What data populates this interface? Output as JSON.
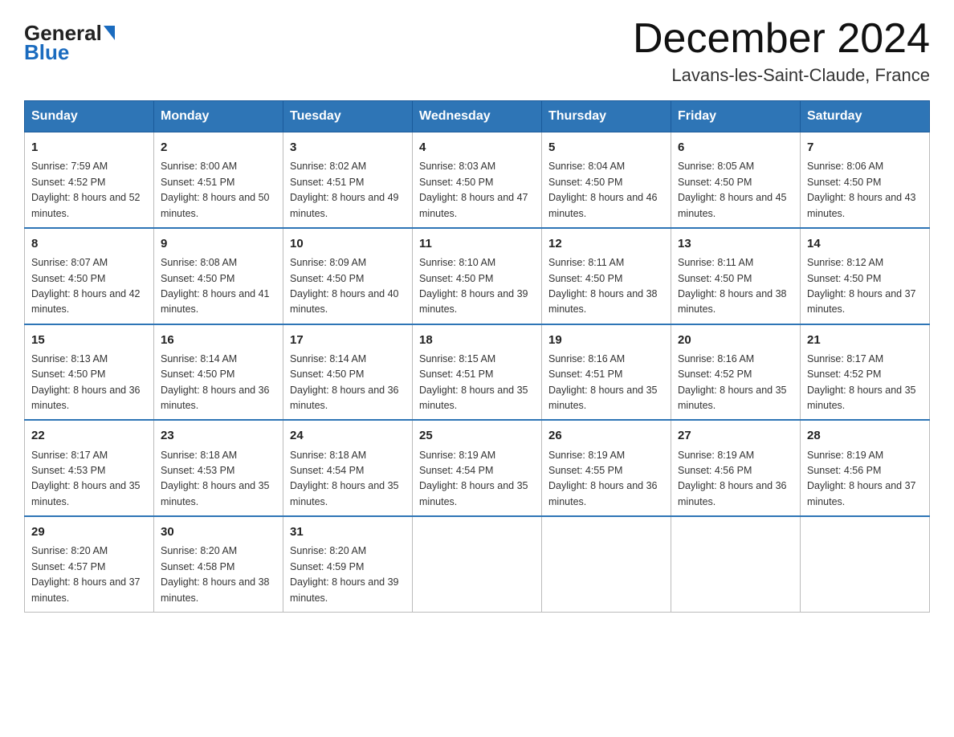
{
  "header": {
    "logo_general": "General",
    "logo_blue": "Blue",
    "month_year": "December 2024",
    "location": "Lavans-les-Saint-Claude, France"
  },
  "days_of_week": [
    "Sunday",
    "Monday",
    "Tuesday",
    "Wednesday",
    "Thursday",
    "Friday",
    "Saturday"
  ],
  "weeks": [
    [
      {
        "day": 1,
        "sunrise": "7:59 AM",
        "sunset": "4:52 PM",
        "daylight": "8 hours and 52 minutes."
      },
      {
        "day": 2,
        "sunrise": "8:00 AM",
        "sunset": "4:51 PM",
        "daylight": "8 hours and 50 minutes."
      },
      {
        "day": 3,
        "sunrise": "8:02 AM",
        "sunset": "4:51 PM",
        "daylight": "8 hours and 49 minutes."
      },
      {
        "day": 4,
        "sunrise": "8:03 AM",
        "sunset": "4:50 PM",
        "daylight": "8 hours and 47 minutes."
      },
      {
        "day": 5,
        "sunrise": "8:04 AM",
        "sunset": "4:50 PM",
        "daylight": "8 hours and 46 minutes."
      },
      {
        "day": 6,
        "sunrise": "8:05 AM",
        "sunset": "4:50 PM",
        "daylight": "8 hours and 45 minutes."
      },
      {
        "day": 7,
        "sunrise": "8:06 AM",
        "sunset": "4:50 PM",
        "daylight": "8 hours and 43 minutes."
      }
    ],
    [
      {
        "day": 8,
        "sunrise": "8:07 AM",
        "sunset": "4:50 PM",
        "daylight": "8 hours and 42 minutes."
      },
      {
        "day": 9,
        "sunrise": "8:08 AM",
        "sunset": "4:50 PM",
        "daylight": "8 hours and 41 minutes."
      },
      {
        "day": 10,
        "sunrise": "8:09 AM",
        "sunset": "4:50 PM",
        "daylight": "8 hours and 40 minutes."
      },
      {
        "day": 11,
        "sunrise": "8:10 AM",
        "sunset": "4:50 PM",
        "daylight": "8 hours and 39 minutes."
      },
      {
        "day": 12,
        "sunrise": "8:11 AM",
        "sunset": "4:50 PM",
        "daylight": "8 hours and 38 minutes."
      },
      {
        "day": 13,
        "sunrise": "8:11 AM",
        "sunset": "4:50 PM",
        "daylight": "8 hours and 38 minutes."
      },
      {
        "day": 14,
        "sunrise": "8:12 AM",
        "sunset": "4:50 PM",
        "daylight": "8 hours and 37 minutes."
      }
    ],
    [
      {
        "day": 15,
        "sunrise": "8:13 AM",
        "sunset": "4:50 PM",
        "daylight": "8 hours and 36 minutes."
      },
      {
        "day": 16,
        "sunrise": "8:14 AM",
        "sunset": "4:50 PM",
        "daylight": "8 hours and 36 minutes."
      },
      {
        "day": 17,
        "sunrise": "8:14 AM",
        "sunset": "4:50 PM",
        "daylight": "8 hours and 36 minutes."
      },
      {
        "day": 18,
        "sunrise": "8:15 AM",
        "sunset": "4:51 PM",
        "daylight": "8 hours and 35 minutes."
      },
      {
        "day": 19,
        "sunrise": "8:16 AM",
        "sunset": "4:51 PM",
        "daylight": "8 hours and 35 minutes."
      },
      {
        "day": 20,
        "sunrise": "8:16 AM",
        "sunset": "4:52 PM",
        "daylight": "8 hours and 35 minutes."
      },
      {
        "day": 21,
        "sunrise": "8:17 AM",
        "sunset": "4:52 PM",
        "daylight": "8 hours and 35 minutes."
      }
    ],
    [
      {
        "day": 22,
        "sunrise": "8:17 AM",
        "sunset": "4:53 PM",
        "daylight": "8 hours and 35 minutes."
      },
      {
        "day": 23,
        "sunrise": "8:18 AM",
        "sunset": "4:53 PM",
        "daylight": "8 hours and 35 minutes."
      },
      {
        "day": 24,
        "sunrise": "8:18 AM",
        "sunset": "4:54 PM",
        "daylight": "8 hours and 35 minutes."
      },
      {
        "day": 25,
        "sunrise": "8:19 AM",
        "sunset": "4:54 PM",
        "daylight": "8 hours and 35 minutes."
      },
      {
        "day": 26,
        "sunrise": "8:19 AM",
        "sunset": "4:55 PM",
        "daylight": "8 hours and 36 minutes."
      },
      {
        "day": 27,
        "sunrise": "8:19 AM",
        "sunset": "4:56 PM",
        "daylight": "8 hours and 36 minutes."
      },
      {
        "day": 28,
        "sunrise": "8:19 AM",
        "sunset": "4:56 PM",
        "daylight": "8 hours and 37 minutes."
      }
    ],
    [
      {
        "day": 29,
        "sunrise": "8:20 AM",
        "sunset": "4:57 PM",
        "daylight": "8 hours and 37 minutes."
      },
      {
        "day": 30,
        "sunrise": "8:20 AM",
        "sunset": "4:58 PM",
        "daylight": "8 hours and 38 minutes."
      },
      {
        "day": 31,
        "sunrise": "8:20 AM",
        "sunset": "4:59 PM",
        "daylight": "8 hours and 39 minutes."
      },
      null,
      null,
      null,
      null
    ]
  ],
  "labels": {
    "sunrise": "Sunrise:",
    "sunset": "Sunset:",
    "daylight": "Daylight:"
  }
}
